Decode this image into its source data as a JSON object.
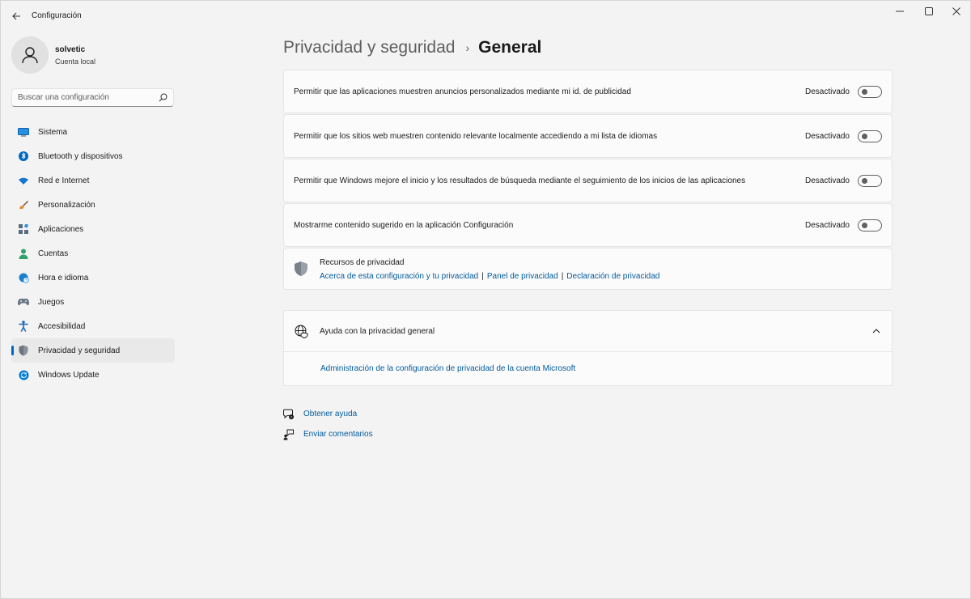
{
  "window": {
    "title": "Configuración"
  },
  "profile": {
    "name": "solvetic",
    "account_type": "Cuenta local"
  },
  "search": {
    "placeholder": "Buscar una configuración"
  },
  "sidebar": {
    "items": [
      {
        "label": "Sistema",
        "icon": "system-icon",
        "color": "#0078d4"
      },
      {
        "label": "Bluetooth y dispositivos",
        "icon": "bluetooth-icon",
        "color": "#0067c0"
      },
      {
        "label": "Red e Internet",
        "icon": "wifi-icon",
        "color": "#1976d2"
      },
      {
        "label": "Personalización",
        "icon": "brush-icon",
        "color": "#e08a2c"
      },
      {
        "label": "Aplicaciones",
        "icon": "apps-icon",
        "color": "#5a6b82"
      },
      {
        "label": "Cuentas",
        "icon": "person-icon",
        "color": "#2fa36b"
      },
      {
        "label": "Hora e idioma",
        "icon": "globe-clock-icon",
        "color": "#1a7fcf"
      },
      {
        "label": "Juegos",
        "icon": "gamepad-icon",
        "color": "#6b7785"
      },
      {
        "label": "Accesibilidad",
        "icon": "accessibility-icon",
        "color": "#1565c0"
      },
      {
        "label": "Privacidad y seguridad",
        "icon": "shield-icon",
        "color": "#7a7f88",
        "active": true
      },
      {
        "label": "Windows Update",
        "icon": "update-icon",
        "color": "#0078d4"
      }
    ]
  },
  "breadcrumb": {
    "parent": "Privacidad y seguridad",
    "separator": "›",
    "current": "General"
  },
  "settings": [
    {
      "label": "Permitir que las aplicaciones muestren anuncios personalizados mediante mi id. de publicidad",
      "state": "Desactivado"
    },
    {
      "label": "Permitir que los sitios web muestren contenido relevante localmente accediendo a mi lista de idiomas",
      "state": "Desactivado"
    },
    {
      "label": "Permitir que Windows mejore el inicio y los resultados de búsqueda mediante el seguimiento de los inicios de las aplicaciones",
      "state": "Desactivado"
    },
    {
      "label": "Mostrarme contenido sugerido en la aplicación Configuración",
      "state": "Desactivado"
    }
  ],
  "resources": {
    "title": "Recursos de privacidad",
    "links": [
      "Acerca de esta configuración y tu privacidad",
      "Panel de privacidad",
      "Declaración de privacidad"
    ],
    "separator": "|"
  },
  "help": {
    "title": "Ayuda con la privacidad general",
    "link": "Administración de la configuración de privacidad de la cuenta Microsoft"
  },
  "footer": {
    "get_help": "Obtener ayuda",
    "feedback": "Enviar comentarios"
  },
  "colors": {
    "accent": "#0067c0",
    "link": "#005a9e"
  }
}
